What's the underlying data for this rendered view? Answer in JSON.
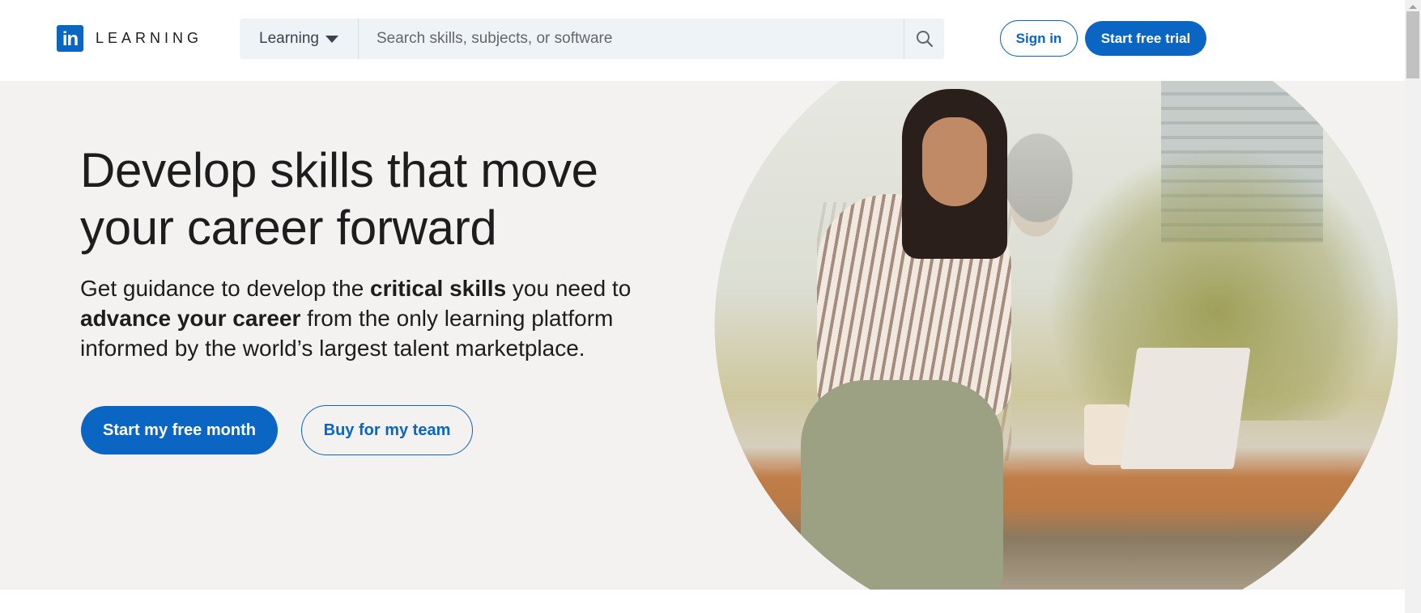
{
  "header": {
    "logo_mark": "in",
    "logo_text": "LEARNING",
    "search": {
      "scope_label": "Learning",
      "placeholder": "Search skills, subjects, or software",
      "value": "",
      "search_icon": "search-icon"
    },
    "sign_in_label": "Sign in",
    "start_trial_label": "Start free trial"
  },
  "hero": {
    "headline": "Develop skills that move your career forward",
    "subtext": {
      "part1": "Get guidance to develop the ",
      "bold1": "critical skills",
      "part2": " you need to ",
      "bold2": "advance your career",
      "part3": " from the only learning platform informed by the world’s largest talent marketplace."
    },
    "primary_cta": "Start my free month",
    "secondary_cta": "Buy for my team",
    "image_description": "Woman in striped shirt writing in notebook while using a laptop"
  },
  "colors": {
    "brand": "#0a66c2",
    "hero_bg": "#f3f2f0",
    "search_bg": "#eef3f8",
    "text": "#1d1d1d"
  }
}
